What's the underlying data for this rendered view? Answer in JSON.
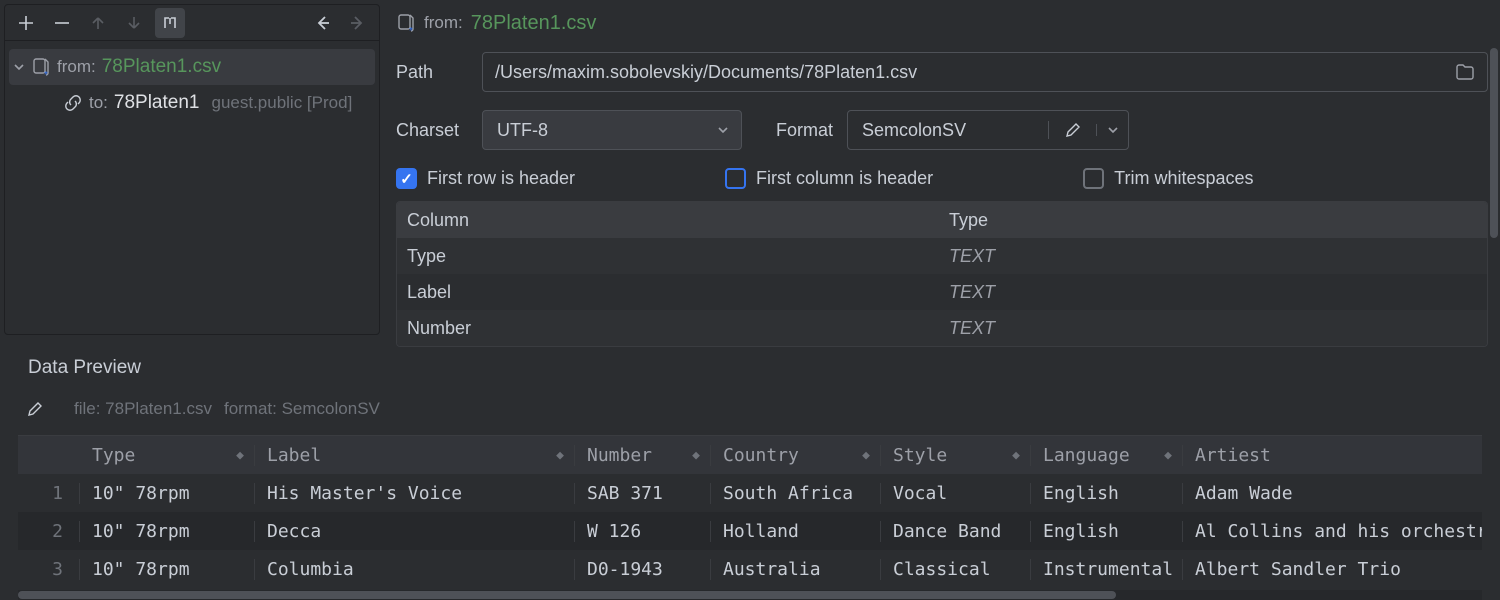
{
  "header": {
    "from_prefix": "from:",
    "filename": "78Platen1.csv"
  },
  "tree": {
    "from_prefix": "from:",
    "from_file": "78Platen1.csv",
    "to_prefix": "to:",
    "to_target": "78Platen1",
    "to_meta": "guest.public [Prod]"
  },
  "form": {
    "path_label": "Path",
    "path_value": "/Users/maxim.sobolevskiy/Documents/78Platen1.csv",
    "charset_label": "Charset",
    "charset_value": "UTF-8",
    "format_label": "Format",
    "format_value": "SemcolonSV",
    "first_row_header": "First row is header",
    "first_col_header": "First column is header",
    "trim_whitespace": "Trim whitespaces"
  },
  "col_table": {
    "head_a": "Column",
    "head_b": "Type",
    "rows": [
      {
        "col": "Type",
        "type": "TEXT"
      },
      {
        "col": "Label",
        "type": "TEXT"
      },
      {
        "col": "Number",
        "type": "TEXT"
      }
    ]
  },
  "preview": {
    "title": "Data Preview",
    "file_meta": "file: 78Platen1.csv",
    "format_meta": "format: SemcolonSV",
    "headers": [
      "Type",
      "Label",
      "Number",
      "Country",
      "Style",
      "Language",
      "Artiest"
    ],
    "rows": [
      {
        "n": "1",
        "Type": "10\" 78rpm",
        "Label": "His Master's Voice",
        "Number": "SAB 371",
        "Country": "South Africa",
        "Style": "Vocal",
        "Language": "English",
        "Artiest": "Adam Wade"
      },
      {
        "n": "2",
        "Type": "10\" 78rpm",
        "Label": "Decca",
        "Number": "W 126",
        "Country": "Holland",
        "Style": "Dance Band",
        "Language": "English",
        "Artiest": "Al Collins and his orchestra"
      },
      {
        "n": "3",
        "Type": "10\" 78rpm",
        "Label": "Columbia",
        "Number": "D0-1943",
        "Country": "Australia",
        "Style": "Classical",
        "Language": "Instrumental",
        "Artiest": "Albert Sandler Trio"
      }
    ]
  }
}
